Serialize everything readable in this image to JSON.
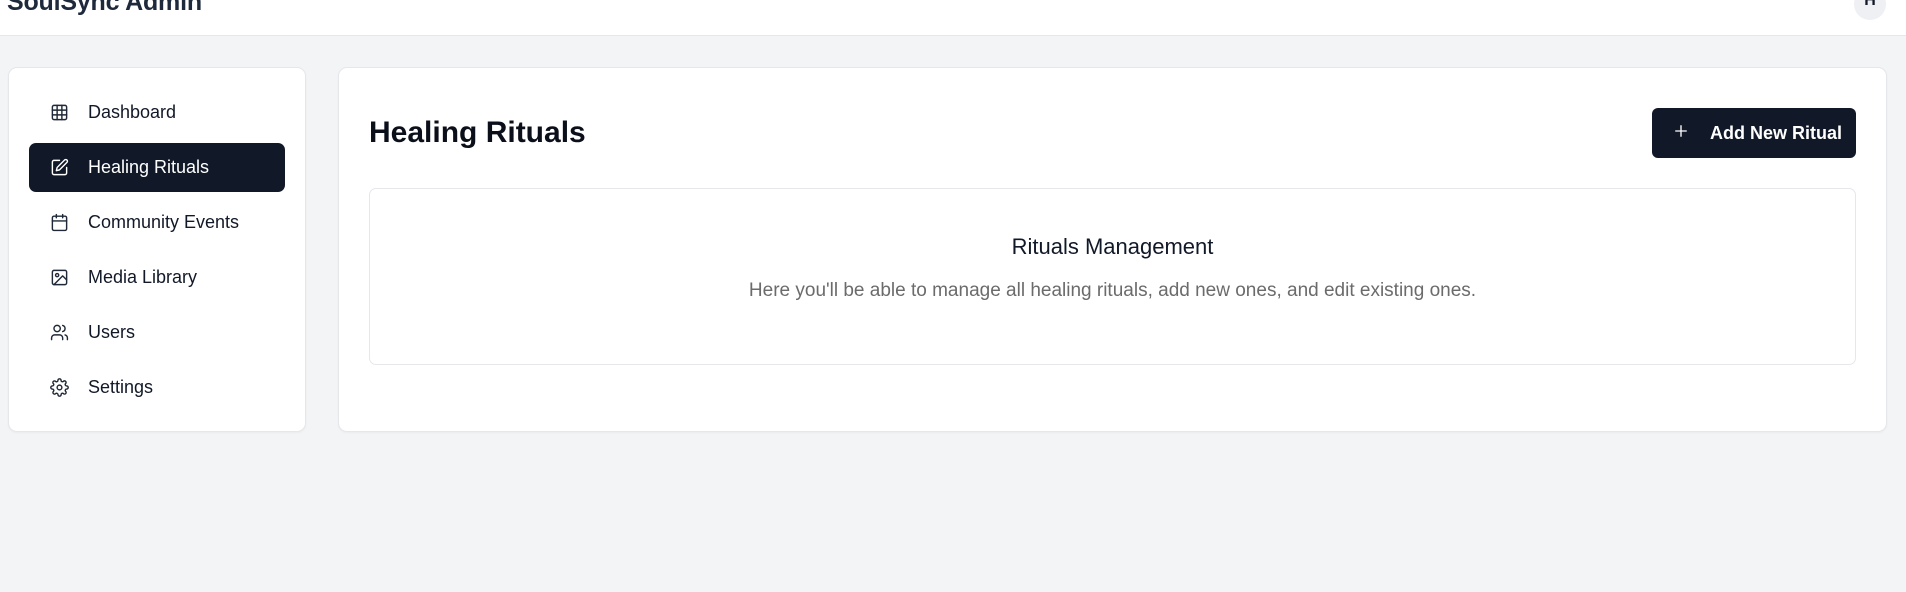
{
  "app": {
    "title": "SoulSync Admin",
    "avatar_initial": "H"
  },
  "sidebar": {
    "items": [
      {
        "label": "Dashboard",
        "icon": "grid-icon",
        "active": false
      },
      {
        "label": "Healing Rituals",
        "icon": "edit-icon",
        "active": true
      },
      {
        "label": "Community Events",
        "icon": "calendar-icon",
        "active": false
      },
      {
        "label": "Media Library",
        "icon": "image-icon",
        "active": false
      },
      {
        "label": "Users",
        "icon": "users-icon",
        "active": false
      },
      {
        "label": "Settings",
        "icon": "gear-icon",
        "active": false
      }
    ]
  },
  "main": {
    "title": "Healing Rituals",
    "add_button_label": "Add New Ritual",
    "info_card": {
      "title": "Rituals Management",
      "text": "Here you'll be able to manage all healing rituals, add new ones, and edit existing ones."
    }
  },
  "colors": {
    "background": "#f3f4f6",
    "surface": "#ffffff",
    "primary_dark": "#111827",
    "muted_text": "#6b6b6b",
    "border": "#e5e7eb"
  }
}
